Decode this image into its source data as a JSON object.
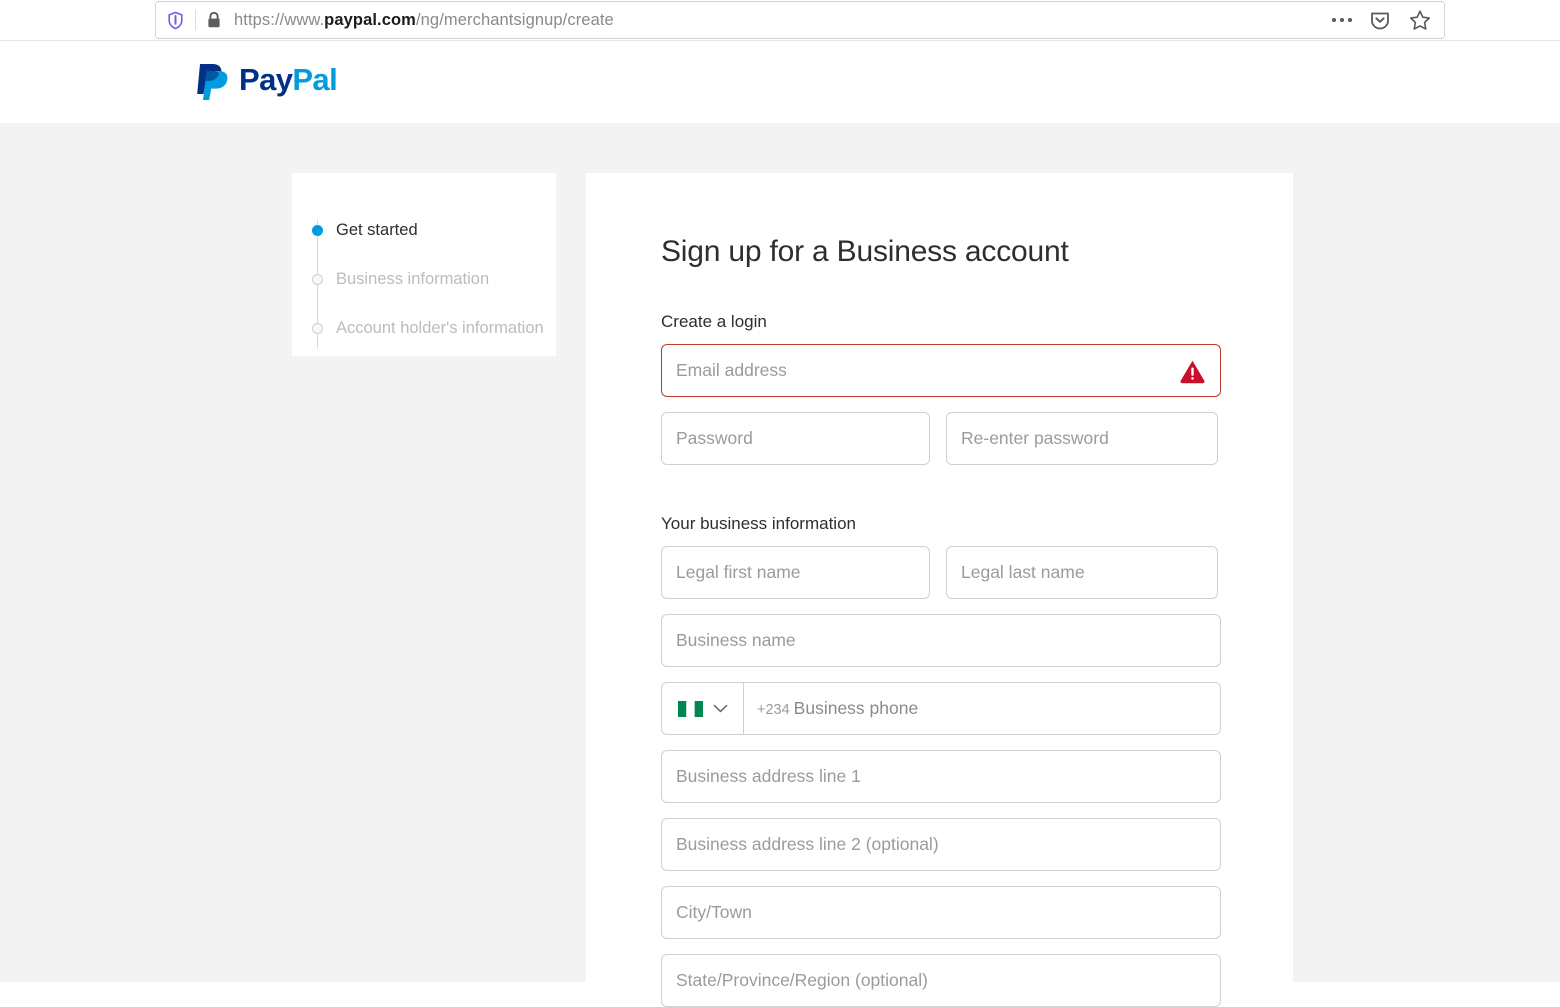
{
  "browser": {
    "shield_icon": "shield-tracking-protection-icon",
    "lock_icon": "padlock-secure-icon",
    "url_prefix": "https://www.",
    "url_domain": "paypal.com",
    "url_path": "/ng/merchantsignup/create",
    "more_icon": "ellipsis-more-icon",
    "pocket_icon": "pocket-save-icon",
    "bookmark_icon": "star-bookmark-icon"
  },
  "header": {
    "logo_pay": "Pay",
    "logo_pal": "Pal",
    "logo_icon": "paypal-monogram-icon"
  },
  "stepper": {
    "steps": [
      {
        "label": "Get started",
        "active": true
      },
      {
        "label": "Business information",
        "active": false
      },
      {
        "label": "Account holder's information",
        "active": false
      }
    ]
  },
  "form": {
    "title": "Sign up for a Business account",
    "login_section_label": "Create a login",
    "business_section_label": "Your business information",
    "email": {
      "placeholder": "Email address",
      "value": "",
      "error": true,
      "error_icon": "warning-triangle-icon"
    },
    "password": {
      "placeholder": "Password",
      "value": ""
    },
    "password_confirm": {
      "placeholder": "Re-enter password",
      "value": ""
    },
    "first_name": {
      "placeholder": "Legal first name",
      "value": ""
    },
    "last_name": {
      "placeholder": "Legal last name",
      "value": ""
    },
    "business_name": {
      "placeholder": "Business name",
      "value": ""
    },
    "phone": {
      "country_flag": "nigeria-flag-icon",
      "chevron_icon": "chevron-down-icon",
      "dial_code": "+234",
      "placeholder": "Business phone",
      "value": ""
    },
    "address_line1": {
      "placeholder": "Business address line 1",
      "value": ""
    },
    "address_line2": {
      "placeholder": "Business address line 2 (optional)",
      "value": ""
    },
    "city": {
      "placeholder": "City/Town",
      "value": ""
    },
    "state": {
      "placeholder": "State/Province/Region (optional)",
      "value": ""
    }
  },
  "colors": {
    "paypal_dark_blue": "#003087",
    "paypal_light_blue": "#009cde",
    "error_red": "#c0392b",
    "page_background": "#f3f3f3"
  }
}
